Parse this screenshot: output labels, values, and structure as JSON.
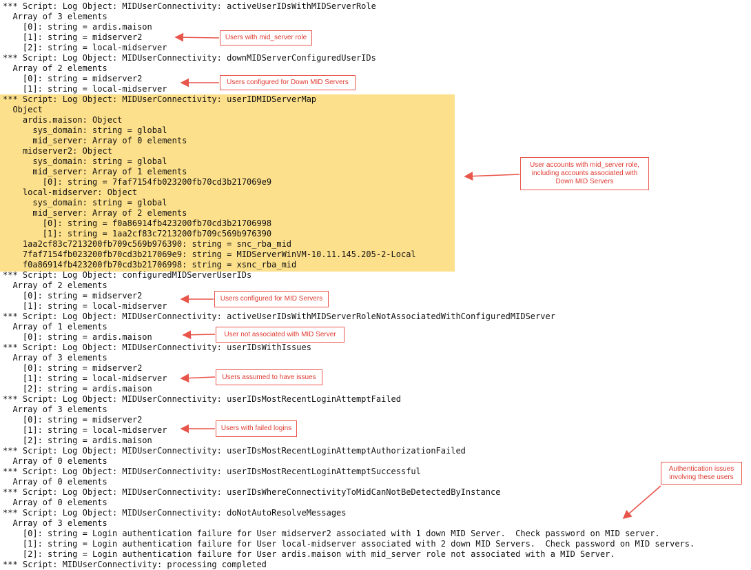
{
  "log_lines": [
    "*** Script: Log Object: MIDUserConnectivity: activeUserIDsWithMIDServerRole",
    "  Array of 3 elements",
    "    [0]: string = ardis.maison",
    "    [1]: string = midserver2",
    "    [2]: string = local-midserver",
    "*** Script: Log Object: MIDUserConnectivity: downMIDServerConfiguredUserIDs",
    "  Array of 2 elements",
    "    [0]: string = midserver2",
    "    [1]: string = local-midserver",
    "*** Script: Log Object: MIDUserConnectivity: userIDMIDServerMap",
    "  Object",
    "    ardis.maison: Object",
    "      sys_domain: string = global",
    "      mid_server: Array of 0 elements",
    "    midserver2: Object",
    "      sys_domain: string = global",
    "      mid_server: Array of 1 elements",
    "        [0]: string = 7faf7154fb023200fb70cd3b217069e9",
    "    local-midserver: Object",
    "      sys_domain: string = global",
    "      mid_server: Array of 2 elements",
    "        [0]: string = f0a86914fb423200fb70cd3b21706998",
    "        [1]: string = 1aa2cf83c7213200fb709c569b976390",
    "    1aa2cf83c7213200fb709c569b976390: string = snc_rba_mid",
    "    7faf7154fb023200fb70cd3b217069e9: string = MIDServerWinVM-10.11.145.205-2-Local",
    "    f0a86914fb423200fb70cd3b21706998: string = xsnc_rba_mid",
    "*** Script: Log Object: configuredMIDServerUserIDs",
    "  Array of 2 elements",
    "    [0]: string = midserver2",
    "    [1]: string = local-midserver",
    "*** Script: Log Object: MIDUserConnectivity: activeUserIDsWithMIDServerRoleNotAssociatedWithConfiguredMIDServer",
    "  Array of 1 elements",
    "    [0]: string = ardis.maison",
    "*** Script: Log Object: MIDUserConnectivity: userIDsWithIssues",
    "  Array of 3 elements",
    "    [0]: string = midserver2",
    "    [1]: string = local-midserver",
    "    [2]: string = ardis.maison",
    "*** Script: Log Object: MIDUserConnectivity: userIDsMostRecentLoginAttemptFailed",
    "  Array of 3 elements",
    "    [0]: string = midserver2",
    "    [1]: string = local-midserver",
    "    [2]: string = ardis.maison",
    "*** Script: Log Object: MIDUserConnectivity: userIDsMostRecentLoginAttemptAuthorizationFailed",
    "  Array of 0 elements",
    "*** Script: Log Object: MIDUserConnectivity: userIDsMostRecentLoginAttemptSuccessful",
    "  Array of 0 elements",
    "*** Script: Log Object: MIDUserConnectivity: userIDsWhereConnectivityToMidCanNotBeDetectedByInstance",
    "  Array of 0 elements",
    "*** Script: Log Object: MIDUserConnectivity: doNotAutoResolveMessages",
    "  Array of 3 elements",
    "    [0]: string = Login authentication failure for User midserver2 associated with 1 down MID Server.  Check password on MID server.",
    "    [1]: string = Login authentication failure for User local-midserver associated with 2 down MID Servers.  Check password on MID servers.",
    "    [2]: string = Login authentication failure for User ardis.maison with mid_server role not associated with a MID Server.",
    "*** Script: MIDUserConnectivity: processing completed"
  ],
  "annotations": {
    "mid_server_role": "Users with mid_server role",
    "down_mid_servers": "Users configured for Down MID Servers",
    "accounts_with_role": "User accounts with mid_server role, including accounts associated with Down MID Servers",
    "configured_mid_servers": "Users configured for MID Servers",
    "not_associated": "User not associated with MID Server",
    "assumed_issues": "Users assumed to have issues",
    "failed_logins": "Users with failed logins",
    "auth_issues": "Authentication issues involving these users"
  },
  "colors": {
    "highlight": "#fde08b",
    "annotation_red": "#e03a30",
    "text": "#111111"
  }
}
